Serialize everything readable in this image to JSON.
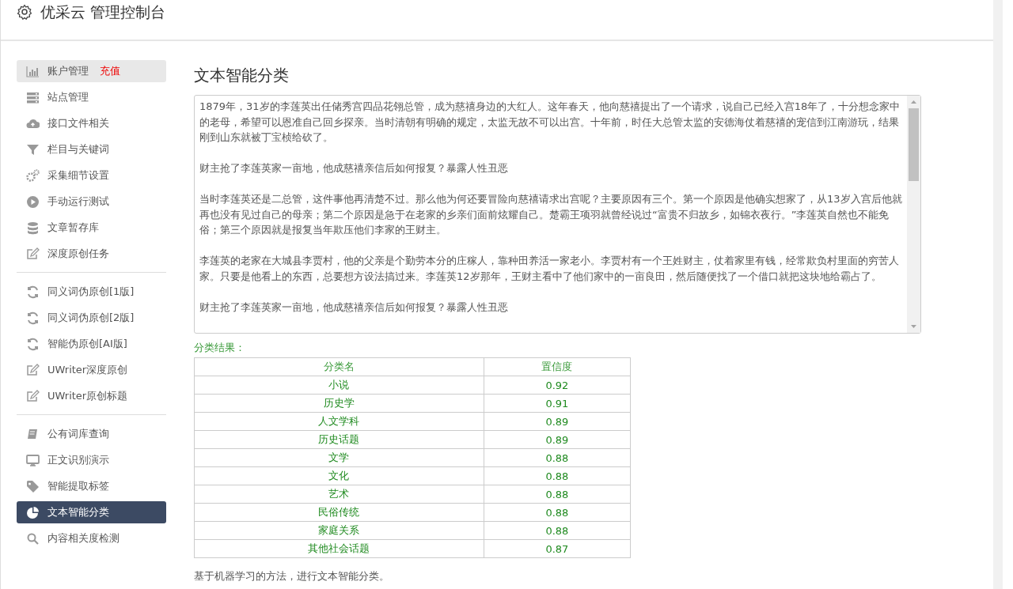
{
  "header": {
    "title": "优采云 管理控制台"
  },
  "sidebar": {
    "groups": [
      [
        {
          "label": "账户管理",
          "badge": "充值",
          "selected": false,
          "highlighted": true
        },
        {
          "label": "站点管理",
          "selected": false,
          "highlighted": false
        },
        {
          "label": "接口文件相关",
          "selected": false,
          "highlighted": false
        },
        {
          "label": "栏目与关键词",
          "selected": false,
          "highlighted": false
        },
        {
          "label": "采集细节设置",
          "selected": false,
          "highlighted": false
        },
        {
          "label": "手动运行测试",
          "selected": false,
          "highlighted": false
        },
        {
          "label": "文章暂存库",
          "selected": false,
          "highlighted": false
        },
        {
          "label": "深度原创任务",
          "selected": false,
          "highlighted": false
        }
      ],
      [
        {
          "label": "同义词伪原创[1版]",
          "selected": false,
          "highlighted": false
        },
        {
          "label": "同义词伪原创[2版]",
          "selected": false,
          "highlighted": false
        },
        {
          "label": "智能伪原创[AI版]",
          "selected": false,
          "highlighted": false
        },
        {
          "label": "UWriter深度原创",
          "selected": false,
          "highlighted": false
        },
        {
          "label": "UWriter原创标题",
          "selected": false,
          "highlighted": false
        }
      ],
      [
        {
          "label": "公有词库查询",
          "selected": false,
          "highlighted": false
        },
        {
          "label": "正文识别演示",
          "selected": false,
          "highlighted": false
        },
        {
          "label": "智能提取标签",
          "selected": false,
          "highlighted": false
        },
        {
          "label": "文本智能分类",
          "selected": true,
          "highlighted": false
        },
        {
          "label": "内容相关度检测",
          "selected": false,
          "highlighted": false
        }
      ]
    ]
  },
  "main": {
    "heading": "文本智能分类",
    "text_area": {
      "paragraphs": [
        "1879年，31岁的李莲英出任储秀宫四品花翎总管，成为慈禧身边的大红人。这年春天，他向慈禧提出了一个请求，说自己已经入宫18年了，十分想念家中的老母，希望可以恩准自己回乡探亲。当时清朝有明确的规定，太监无故不可以出宫。十年前，时任大总管太监的安德海仗着慈禧的宠信到江南游玩，结果刚到山东就被丁宝桢给砍了。",
        "财主抢了李莲英家一亩地，他成慈禧亲信后如何报复？暴露人性丑恶",
        "当时李莲英还是二总管，这件事他再清楚不过。那么他为何还要冒险向慈禧请求出宫呢？主要原因有三个。第一个原因是他确实想家了，从13岁入宫后他就再也没有见过自己的母亲；第二个原因是急于在老家的乡亲们面前炫耀自己。楚霸王项羽就曾经说过“富贵不归故乡，如锦衣夜行。”李莲英自然也不能免俗；第三个原因就是报复当年欺压他们李家的王财主。",
        "李莲英的老家在大城县李贾村，他的父亲是个勤劳本分的庄稼人，靠种田养活一家老小。李贾村有一个王姓财主，仗着家里有钱，经常欺负村里面的穷苦人家。只要是他看上的东西，总要想方设法搞过来。李莲英12岁那年，王财主看中了他们家中的一亩良田，然后随便找了一个借口就把这块地给霸占了。",
        "财主抢了李莲英家一亩地，他成慈禧亲信后如何报复？暴露人性丑恶"
      ]
    },
    "result_label": "分类结果：",
    "table": {
      "columns": [
        "分类名",
        "置信度"
      ],
      "rows": [
        [
          "小说",
          "0.92"
        ],
        [
          "历史学",
          "0.91"
        ],
        [
          "人文学科",
          "0.89"
        ],
        [
          "历史话题",
          "0.89"
        ],
        [
          "文学",
          "0.88"
        ],
        [
          "文化",
          "0.88"
        ],
        [
          "艺术",
          "0.88"
        ],
        [
          "民俗传统",
          "0.88"
        ],
        [
          "家庭关系",
          "0.88"
        ],
        [
          "其他社会话题",
          "0.87"
        ]
      ]
    },
    "note": "基于机器学习的方法，进行文本智能分类。"
  }
}
